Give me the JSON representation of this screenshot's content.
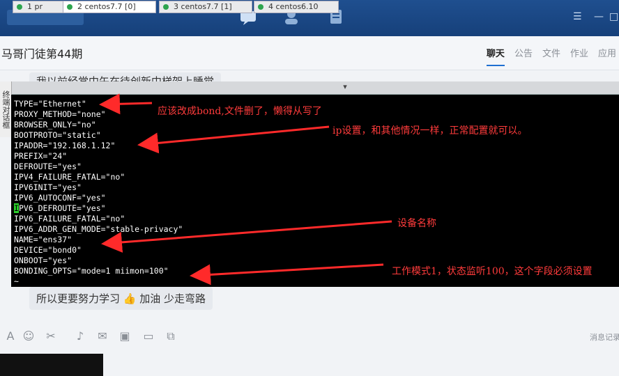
{
  "chat": {
    "title": "马哥门徒第44期",
    "tabs": [
      "聊天",
      "公告",
      "文件",
      "作业",
      "应用"
    ],
    "top_message": "我以前经常中午在待创新中梯架上睡觉",
    "bottom_message": "所以更要努力学习",
    "bottom_emoji_text": "加油 少走弯路",
    "bottom_right_hint": "消息记录"
  },
  "terminal": {
    "tabs": [
      "1 pr",
      "2 centos7.7 [0]",
      "3 centos7.7 [1]",
      "4 centos6.10"
    ],
    "side_label": "终端对话框",
    "lines": [
      "TYPE=\"Ethernet\"",
      "PROXY_METHOD=\"none\"",
      "BROWSER_ONLY=\"no\"",
      "BOOTPROTO=\"static\"",
      "IPADDR=\"192.168.1.12\"",
      "PREFIX=\"24\"",
      "DEFROUTE=\"yes\"",
      "IPV4_FAILURE_FATAL=\"no\"",
      "IPV6INIT=\"yes\"",
      "IPV6_AUTOCONF=\"yes\"",
      "IPV6_DEFROUTE=\"yes\"",
      "IPV6_FAILURE_FATAL=\"no\"",
      "IPV6_ADDR_GEN_MODE=\"stable-privacy\"",
      "NAME=\"ens37\"",
      "DEVICE=\"bond0\"",
      "ONBOOT=\"yes\"",
      "BONDING_OPTS=\"mode=1 miimon=100\"",
      "~"
    ],
    "cursor_char": "I",
    "line10_rest": "PV6_DEFROUTE=\"yes\""
  },
  "annotations": {
    "type_note": "应该改成bond,文件删了，懒得从写了",
    "ip_note": "ip设置，和其他情况一样，正常配置就可以。",
    "name_note": "设备名称",
    "bonding_note": "工作模式1，状态监听100，这个字段必须设置"
  },
  "colors": {
    "terminal_bg": "#000000",
    "terminal_text": "#ffffff",
    "annotation": "#ff3b3b",
    "topbar": "#1f4f8f",
    "cursor": "#2bd02b"
  }
}
